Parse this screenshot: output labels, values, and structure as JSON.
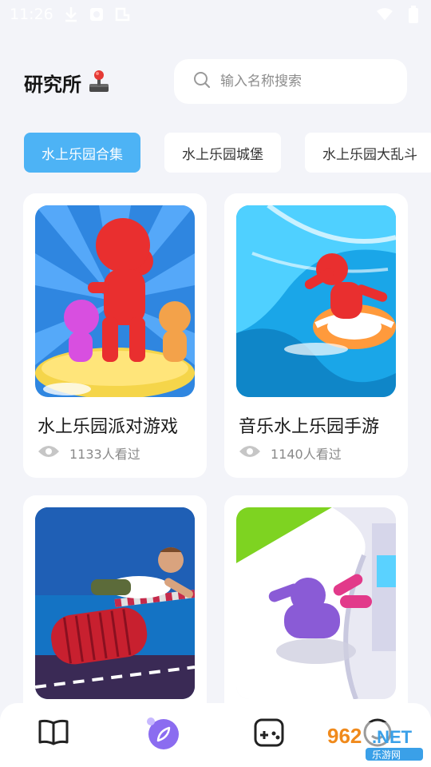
{
  "status_bar": {
    "time": "11:26",
    "left_icons": [
      "download-icon",
      "record-icon",
      "phone-icon"
    ],
    "right_icons": [
      "wifi-icon",
      "battery-icon"
    ]
  },
  "header": {
    "title": "研究所",
    "title_icon": "joystick-icon",
    "search": {
      "placeholder": "输入名称搜索",
      "value": "",
      "icon": "search-icon"
    }
  },
  "tabs": [
    {
      "label": "水上乐园合集",
      "active": true
    },
    {
      "label": "水上乐园城堡",
      "active": false
    },
    {
      "label": "水上乐园大乱斗",
      "active": false
    }
  ],
  "cards": [
    {
      "title": "水上乐园派对游戏",
      "views": "1133人看过"
    },
    {
      "title": "音乐水上乐园手游",
      "views": "1140人看过"
    },
    {
      "title": "",
      "views": ""
    },
    {
      "title": "",
      "views": ""
    }
  ],
  "bottom_nav": [
    {
      "icon": "book-icon",
      "active": false
    },
    {
      "icon": "compass-icon",
      "active": true
    },
    {
      "icon": "gamepad-icon",
      "active": false
    },
    {
      "icon": "profile-icon",
      "active": false
    }
  ],
  "watermark": {
    "text_top": "962.NET",
    "text_bottom": "乐游网"
  },
  "colors": {
    "accent": "#4db3f5",
    "background": "#f3f4f9",
    "nav_active": "#8b6cf0"
  }
}
